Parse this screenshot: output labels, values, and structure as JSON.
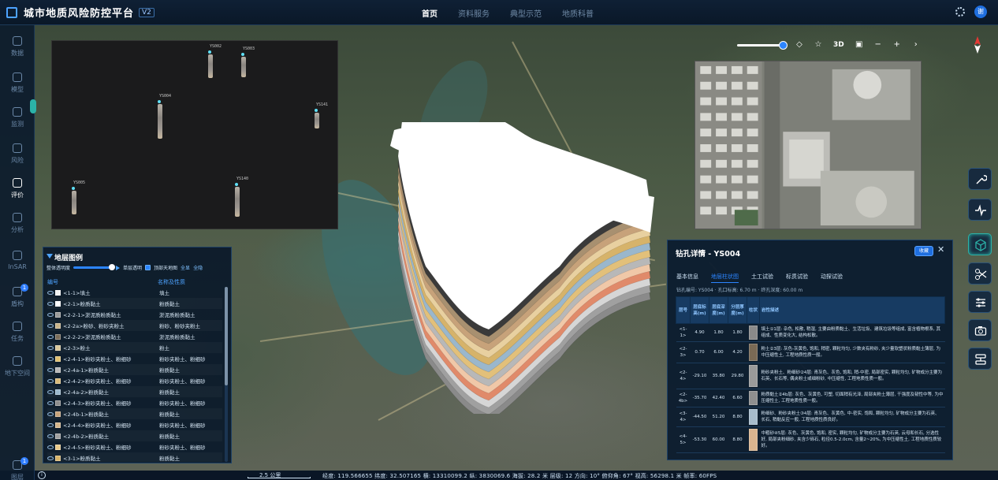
{
  "app": {
    "title": "城市地质风险防控平台",
    "version": "V2"
  },
  "nav": {
    "items": [
      "首页",
      "资料服务",
      "典型示范",
      "地质科普"
    ],
    "active_index": 0
  },
  "header": {
    "user_initial": "谢"
  },
  "sidebar": {
    "items": [
      {
        "label": "数据",
        "icon": "layers-icon",
        "badge": ""
      },
      {
        "label": "模型",
        "icon": "cube-icon",
        "badge": ""
      },
      {
        "label": "监测",
        "icon": "pulse-icon",
        "badge": ""
      },
      {
        "label": "风险",
        "icon": "alert-icon",
        "badge": ""
      },
      {
        "label": "评价",
        "icon": "home-icon",
        "badge": ""
      },
      {
        "label": "分析",
        "icon": "chart-icon",
        "badge": ""
      },
      {
        "label": "InSAR",
        "icon": "radar-icon",
        "badge": ""
      },
      {
        "label": "盾构",
        "icon": "tunnel-icon",
        "badge": "1"
      },
      {
        "label": "任务",
        "icon": "task-icon",
        "badge": ""
      },
      {
        "label": "地下空间",
        "icon": "underground-icon",
        "badge": ""
      },
      {
        "label": "图层",
        "icon": "map-layers-icon",
        "badge": "1"
      }
    ],
    "active_index": 4
  },
  "boreholes": {
    "labels": [
      "YS002",
      "YS003",
      "YS004",
      "YS141",
      "YS005",
      "YS140"
    ]
  },
  "legend": {
    "title": "地层图例",
    "opacity_label": "整体透明度",
    "opacity_value": 85,
    "single_transparent": "单层透明",
    "top_sky_label": "顶部天地图",
    "all_label": "全显",
    "hide_label": "全隐",
    "col_code": "编号",
    "col_name": "名称及性质",
    "rows": [
      {
        "code": "<1-1>填土",
        "name": "填土",
        "color": "#f2f2f2"
      },
      {
        "code": "<2-1>粉质黏土",
        "name": "粉质黏土",
        "color": "#ffffff"
      },
      {
        "code": "<2-2-1>淤泥质粉质黏土",
        "name": "淤泥质粉质黏土",
        "color": "#9a9a9a"
      },
      {
        "code": "<2-2a>粉砂、粉砂夹粉土",
        "name": "粉砂、粉砂夹粉土",
        "color": "#c9b48a"
      },
      {
        "code": "<2-2-2>淤泥质粉质黏土",
        "name": "淤泥质粉质黏土",
        "color": "#7a6d5a"
      },
      {
        "code": "<2-3>粉土",
        "name": "粉土",
        "color": "#d8c79a"
      },
      {
        "code": "<2-4-1>粉砂夹粉土、粉细砂",
        "name": "粉砂夹粉土、粉细砂",
        "color": "#e0c070"
      },
      {
        "code": "<2-4a-1>粉质黏土",
        "name": "粉质黏土",
        "color": "#b8b8b8"
      },
      {
        "code": "<2-4-2>粉砂夹粉土、粉细砂",
        "name": "粉砂夹粉土、粉细砂",
        "color": "#d9b978"
      },
      {
        "code": "<2-4a-2>粉质黏土",
        "name": "粉质黏土",
        "color": "#9ab7cc"
      },
      {
        "code": "<2-4-3>粉砂夹粉土、粉细砂",
        "name": "粉砂夹粉土、粉细砂",
        "color": "#8c8c8c"
      },
      {
        "code": "<2-4b-1>粉质黏土",
        "name": "粉质黏土",
        "color": "#c7a37a"
      },
      {
        "code": "<2-4-4>粉砂夹粉土、粉细砂",
        "name": "粉砂夹粉土、粉细砂",
        "color": "#d3b48a"
      },
      {
        "code": "<2-4b-2>粉质黏土",
        "name": "粉质黏土",
        "color": "#a0a0a0"
      },
      {
        "code": "<2-4-5>粉砂夹粉土、粉细砂",
        "name": "粉砂夹粉土、粉细砂",
        "color": "#e8c98a"
      },
      {
        "code": "<3-1>粉质黏土",
        "name": "粉质黏土",
        "color": "#d7b46a"
      }
    ]
  },
  "detail": {
    "title": "钻孔详情 - YS004",
    "fav_label": "收藏",
    "tabs": [
      "基本信息",
      "地层柱状图",
      "土工试验",
      "标贯试验",
      "动探试验"
    ],
    "active_tab": 1,
    "info": "钻孔编号: YS004 · 孔口标高: 6.70 m · 终孔深度: 60.00 m",
    "columns": [
      "层号",
      "层底标高(m)",
      "层底深度(m)",
      "分层厚度(m)",
      "柱状",
      "岩性描述"
    ],
    "rows": [
      {
        "layer": "<1-1>",
        "elev": "4.90",
        "depth": "1.80",
        "thick": "1.80",
        "color": "#8a8a8a",
        "desc": "填土①1层: 杂色, 松散, 稍湿, 主要由粉质黏土、生活垃圾、建筑垃圾等组成, 富含植物根系, 其组成、性质变化大, 结构松散。"
      },
      {
        "layer": "<2-3>",
        "elev": "0.70",
        "depth": "6.00",
        "thick": "4.20",
        "color": "#7a6a55",
        "desc": "粉土②3层: 灰色-灰黄色, 饱和, 稍密, 颗粒均匀, 少数夹有粉砂, 夹少量软塑状粉质黏土薄层, 为中压缩性土, 工程地质性质一般。"
      },
      {
        "layer": "<2-4>",
        "elev": "-29.10",
        "depth": "35.80",
        "thick": "29.80",
        "color": "#9a9a9a",
        "desc": "粉砂夹粉土、粉细砂②4层: 青灰色、灰色, 饱和, 稍-中密, 局部密实, 颗粒均匀, 矿物成分主要为石英、长石等, 偶夹粉土或细粉砂, 中压缩性, 工程地质性质一般。"
      },
      {
        "layer": "<2-4b>",
        "elev": "-35.70",
        "depth": "42.40",
        "thick": "6.60",
        "color": "#8f8f8f",
        "desc": "粉质黏土②4b层: 灰色、灰黄色, 可塑, 切面稍有光泽, 局部夹粉土薄层, 干强度及韧性中等, 为中压缩性土, 工程地质性质一般。"
      },
      {
        "layer": "<3-4>",
        "elev": "-44.50",
        "depth": "51.20",
        "thick": "8.80",
        "color": "#a7bccc",
        "desc": "粉细砂、粉砂夹粉土③4层: 青灰色、灰黄色, 中-密实, 饱和, 颗粒均匀, 矿物成分主要为石英、长石, 稍黏反应一般, 工程地质性质良好。"
      },
      {
        "layer": "<4-5>",
        "elev": "-53.30",
        "depth": "60.00",
        "thick": "8.80",
        "color": "#d9b48f",
        "desc": "中粗砂④5层: 灰色、灰黄色, 饱和, 密实, 颗粒均匀, 矿物成分主要为石英, 云母和长石, 分选性好, 局部夹粉细砂, 夹含少砾石, 粒径0.5-2.0cm, 含量2~20%, 为中压缩性土, 工程地质性质较好。"
      }
    ]
  },
  "maptool": {
    "mode_3d": "3D"
  },
  "status": {
    "scale": "2.5 公里",
    "readout": "经度: 119.566655   纬度: 32.507165   横: 13310099.2   纵: 3830069.6   海拔: 28.2 米   层级: 12   方向: 10°   俯仰角: 67°   视高: 56298.1 米   帧率: 60FPS"
  }
}
